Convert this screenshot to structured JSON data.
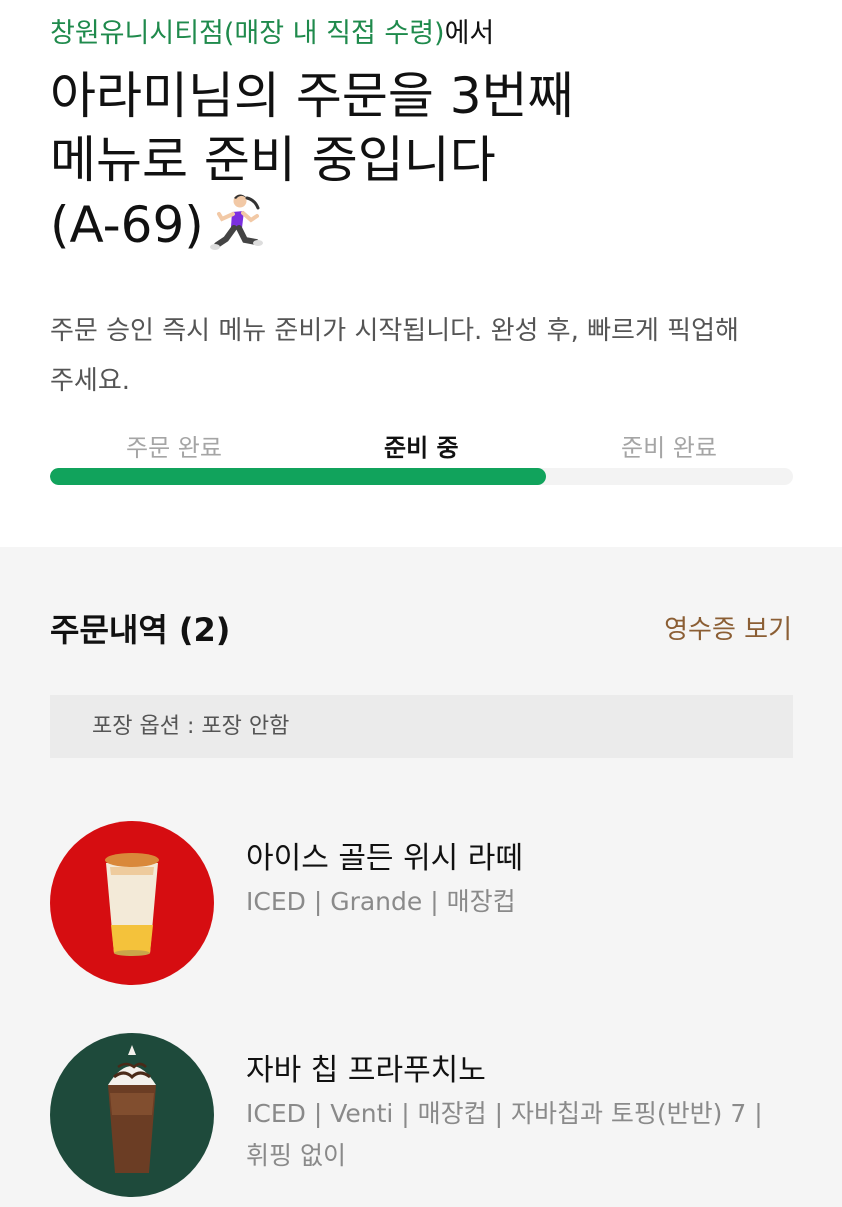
{
  "header": {
    "store_name": "창원유니시티점(매장 내 직접 수령)",
    "store_suffix": "에서",
    "headline_line1": "아라미님의 주문을 3번째",
    "headline_line2": "메뉴로 준비 중입니다",
    "headline_line3": "(A-69)",
    "runner_icon": "person-running-icon",
    "description": "주문 승인 즉시 메뉴 준비가 시작됩니다. 완성 후, 빠르게 픽업해 주세요."
  },
  "progress": {
    "steps": [
      "주문 완료",
      "준비 중",
      "준비 완료"
    ],
    "current_step": 1,
    "fraction": 0.667,
    "color": "#11a35c"
  },
  "order": {
    "title": "주문내역 (2)",
    "receipt_label": "영수증 보기",
    "packaging": "포장 옵션 : 포장 안함",
    "items": [
      {
        "name": "아이스 골든 위시 라떼",
        "options": "ICED | Grande | 매장컵",
        "thumb_color": "#d60d11"
      },
      {
        "name": "자바 칩 프라푸치노",
        "options": "ICED | Venti | 매장컵 | 자바칩과 토핑(반반) 7 | 휘핑 없이",
        "thumb_color": "#1e4a3b"
      }
    ]
  },
  "colors": {
    "brand_green": "#1f8a4c",
    "receipt_brown": "#8b5e34"
  }
}
